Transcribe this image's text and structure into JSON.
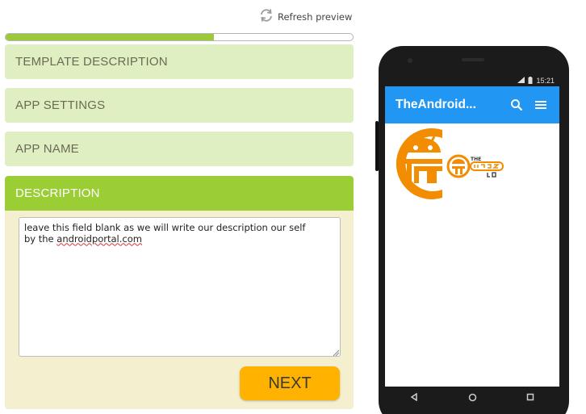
{
  "toolbar": {
    "refresh_label": "Refresh preview"
  },
  "progress": {
    "fraction": 0.6
  },
  "sections": [
    {
      "label": "TEMPLATE DESCRIPTION"
    },
    {
      "label": "APP SETTINGS"
    },
    {
      "label": "APP NAME"
    },
    {
      "label": "DESCRIPTION"
    }
  ],
  "description": {
    "line1": "leave this field blank as we will write our description our self",
    "line2_prefix": "by the ",
    "line2_link": "androidportal.com"
  },
  "next_label": "NEXT",
  "phone": {
    "time": "15:21",
    "app_title": "TheAndroid...",
    "logo_text": "THE",
    "accent": "#2196f3"
  },
  "colors": {
    "progress": "#9bc93a",
    "section_collapsed": "#e0efc2",
    "section_active": "#9bcd35",
    "panel": "#f4efce",
    "next": "#ffb300",
    "logo_orange": "#f28c00"
  }
}
